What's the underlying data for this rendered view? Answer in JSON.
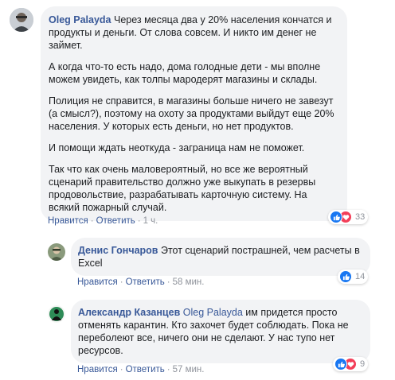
{
  "colors": {
    "link": "#385898",
    "meta": "#90949c",
    "bubble": "#f2f3f5",
    "like": "#1877f2",
    "love": "#f33e58"
  },
  "comment_main": {
    "author": "Oleg Palayda",
    "paragraphs": [
      "Через месяца два у 20% населения кончатся и продукты и деньги. От слова совсем. И никто им денег не займет.",
      "А когда что-то есть надо, дома голодные дети - мы вполне можем увидеть, как толпы мародерят магазины и склады.",
      "Полиция не справится, в магазины больше ничего не завезут (а смысл?), поэтому на охоту за продуктами выйдут еще 20% населения. У которых есть деньги, но нет продуктов.",
      "И помощи ждать неоткуда - заграница нам не поможет.",
      "Так что как очень маловероятный, но все же вероятный сценарий правительство должно уже выкупать в резервы продовольствие, разрабатывать карточную систему. На всякий пожарный случай."
    ],
    "like_label": "Нравится",
    "reply_label": "Ответить",
    "time": "1 ч.",
    "reaction_icons": [
      "like-icon",
      "love-icon"
    ],
    "reaction_count": "33"
  },
  "reply_1": {
    "author": "Денис Гончаров",
    "text": "Этот сценарий пострашней, чем расчеты в Excel",
    "like_label": "Нравится",
    "reply_label": "Ответить",
    "time": "58 мин.",
    "reaction_icons": [
      "like-icon"
    ],
    "reaction_count": "14"
  },
  "reply_2": {
    "author": "Александр Казанцев",
    "mention": "Oleg Palayda",
    "text": "им придется просто отменять карантин. Кто захочет будет соблюдать. Пока не переболеют все, ничего они не сделают. У нас тупо нет ресурсов.",
    "like_label": "Нравится",
    "reply_label": "Ответить",
    "time": "57 мин.",
    "reaction_icons": [
      "like-icon",
      "love-icon"
    ],
    "reaction_count": "9"
  }
}
